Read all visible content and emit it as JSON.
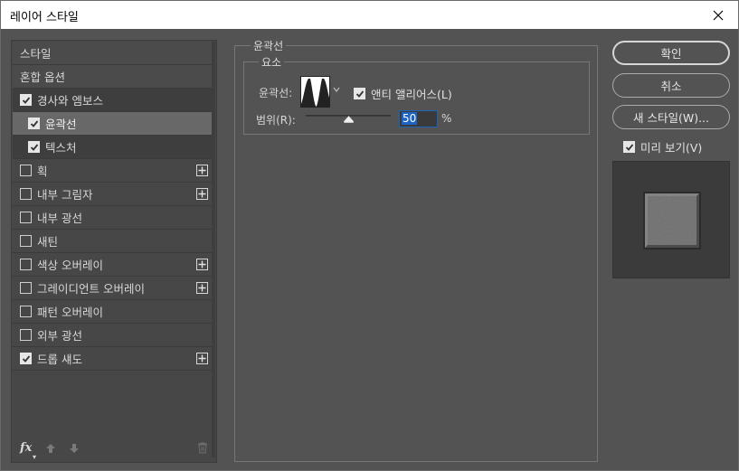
{
  "window": {
    "title": "레이어 스타일"
  },
  "left_panel": {
    "items": [
      {
        "label": "스타일",
        "type": "header"
      },
      {
        "label": "혼합 옵션",
        "type": "header"
      },
      {
        "label": "경사와 엠보스",
        "checked": true,
        "type": "dark"
      },
      {
        "label": "윤곽선",
        "checked": true,
        "type": "selected-sub"
      },
      {
        "label": "텍스처",
        "checked": true,
        "type": "dark-sub"
      },
      {
        "label": "획",
        "checked": false,
        "plus": true
      },
      {
        "label": "내부 그림자",
        "checked": false,
        "plus": true
      },
      {
        "label": "내부 광선",
        "checked": false
      },
      {
        "label": "새틴",
        "checked": false
      },
      {
        "label": "색상 오버레이",
        "checked": false,
        "plus": true
      },
      {
        "label": "그레이디언트 오버레이",
        "checked": false,
        "plus": true
      },
      {
        "label": "패턴 오버레이",
        "checked": false
      },
      {
        "label": "외부 광선",
        "checked": false
      },
      {
        "label": "드롭 섀도",
        "checked": true,
        "plus": true
      }
    ],
    "footer": {
      "fx_label": "fx"
    }
  },
  "contour_group": {
    "outer_legend": "윤곽선",
    "inner_legend": "요소",
    "contour_label": "윤곽선:",
    "anti_alias_label": "앤티 앨리어스(L)",
    "anti_alias_checked": true,
    "range_label": "범위(R):",
    "range_value": "50",
    "range_unit": "%",
    "range_percent": 50
  },
  "buttons": {
    "ok": "확인",
    "cancel": "취소",
    "new_style": "새 스타일(W)..."
  },
  "preview": {
    "label": "미리 보기(V)",
    "checked": true
  },
  "colors": {
    "background": "#535353",
    "panel": "#474747",
    "selected": "#686868",
    "accent": "#1c63c4"
  }
}
